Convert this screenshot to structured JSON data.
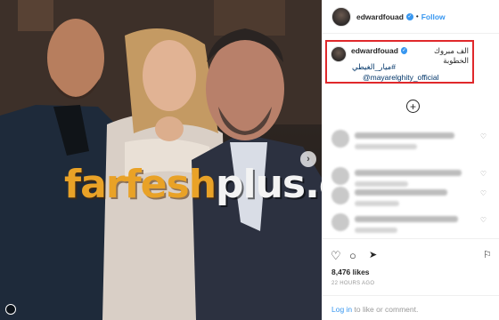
{
  "post": {
    "username": "edwardfouad",
    "follow_label": "Follow",
    "header_dot": "•",
    "caption_arabic": "الف مبروك الخطوبة",
    "caption_hashtag": "#ميار_الغيطي",
    "caption_mention": "@mayarelghity_official",
    "likes": "8,476 likes",
    "time": "22 HOURS AGO",
    "login_link": "Log in",
    "login_rest": " to like or comment."
  },
  "watermark": {
    "part1": "farfesh",
    "part2": "plus.com"
  },
  "comments": [
    {
      "id": 1
    },
    {
      "id": 2
    },
    {
      "id": 3
    },
    {
      "id": 4
    }
  ],
  "icons": {
    "verified": "✓",
    "load_more": "+",
    "next_arrow": "›",
    "heart": "♡",
    "comment": "○",
    "share": "➤",
    "bookmark": "⚐"
  },
  "colors": {
    "follow_blue": "#3897f0",
    "highlight_red": "#e0282b",
    "watermark_orange": "#e9a227"
  }
}
